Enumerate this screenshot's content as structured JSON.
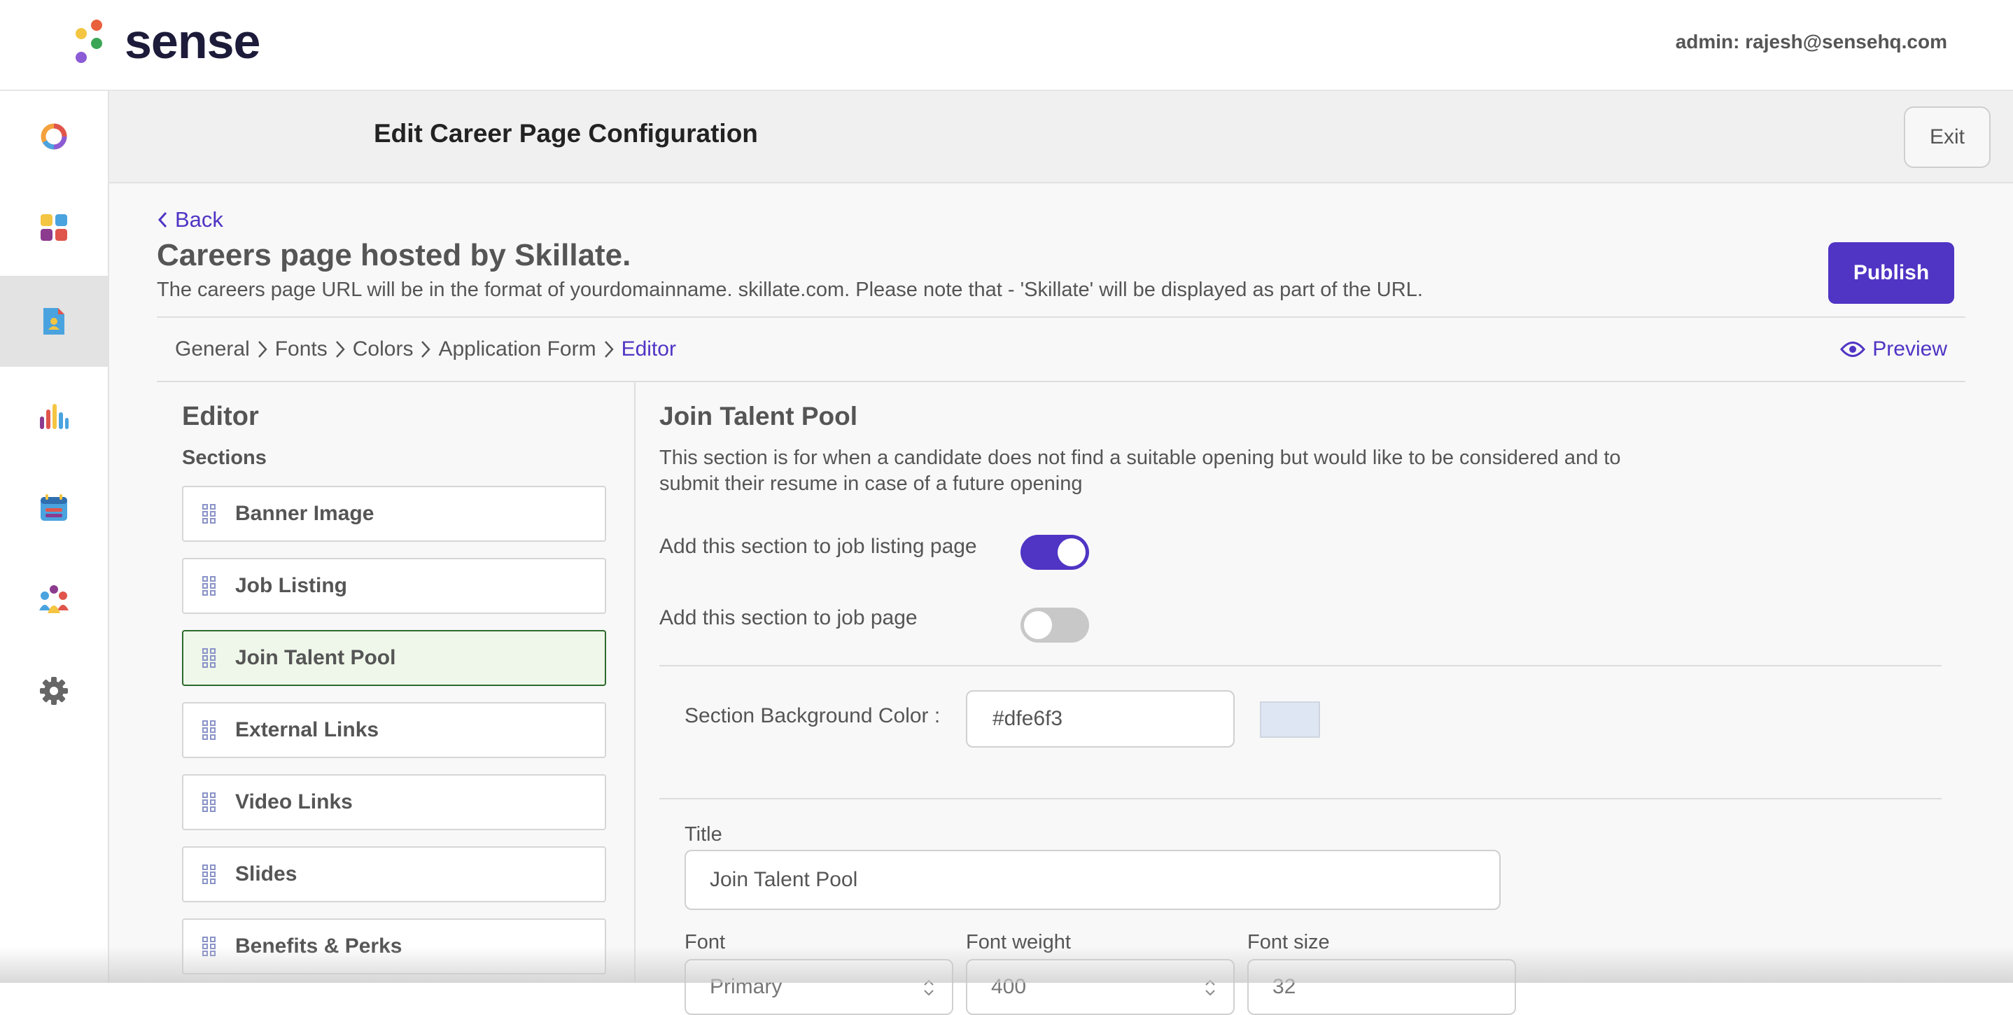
{
  "brand": {
    "name": "sense",
    "dot_colors": [
      "#f4c542",
      "#e8603c",
      "#3aa655",
      "#8c5bd6"
    ]
  },
  "header": {
    "admin": "admin: rajesh@sensehq.com"
  },
  "rail": {
    "items": [
      {
        "icon": "donut-chart-icon"
      },
      {
        "icon": "apps-grid-icon"
      },
      {
        "icon": "career-page-icon",
        "active": true
      },
      {
        "icon": "bar-chart-icon"
      },
      {
        "icon": "calendar-icon"
      },
      {
        "icon": "team-icon"
      },
      {
        "icon": "gear-icon"
      }
    ]
  },
  "titlebar": {
    "title": "Edit Career Page Configuration",
    "exit": "Exit"
  },
  "page": {
    "back": "Back",
    "title": "Careers page hosted by Skillate.",
    "description": "The careers page URL will be in the format of yourdomainname. skillate.com. Please note that - 'Skillate' will be displayed as part of the URL.",
    "publish": "Publish",
    "preview": "Preview",
    "accent_color": "#5034c4"
  },
  "breadcrumbs": [
    "General",
    "Fonts",
    "Colors",
    "Application Form",
    "Editor"
  ],
  "editor": {
    "heading": "Editor",
    "sections_heading": "Sections",
    "sections": [
      "Banner Image",
      "Job Listing",
      "Join Talent Pool",
      "External Links",
      "Video Links",
      "Slides",
      "Benefits & Perks"
    ],
    "active_section": "Join Talent Pool"
  },
  "detail": {
    "heading": "Join Talent Pool",
    "description": "This section is for when a candidate does not find a suitable opening but would like to be considered and to submit their resume in case of a future opening",
    "toggle_listing_label": "Add this section to job listing page",
    "toggle_listing_on": true,
    "toggle_job_label": "Add this section to job page",
    "toggle_job_on": false,
    "bg_color_label": "Section Background Color :",
    "bg_color_value": "#dfe6f3",
    "title_label": "Title",
    "title_value": "Join Talent Pool",
    "font_label": "Font",
    "font_value": "Primary",
    "font_weight_label": "Font weight",
    "font_weight_value": "400",
    "font_size_label": "Font size",
    "font_size_value": "32"
  }
}
